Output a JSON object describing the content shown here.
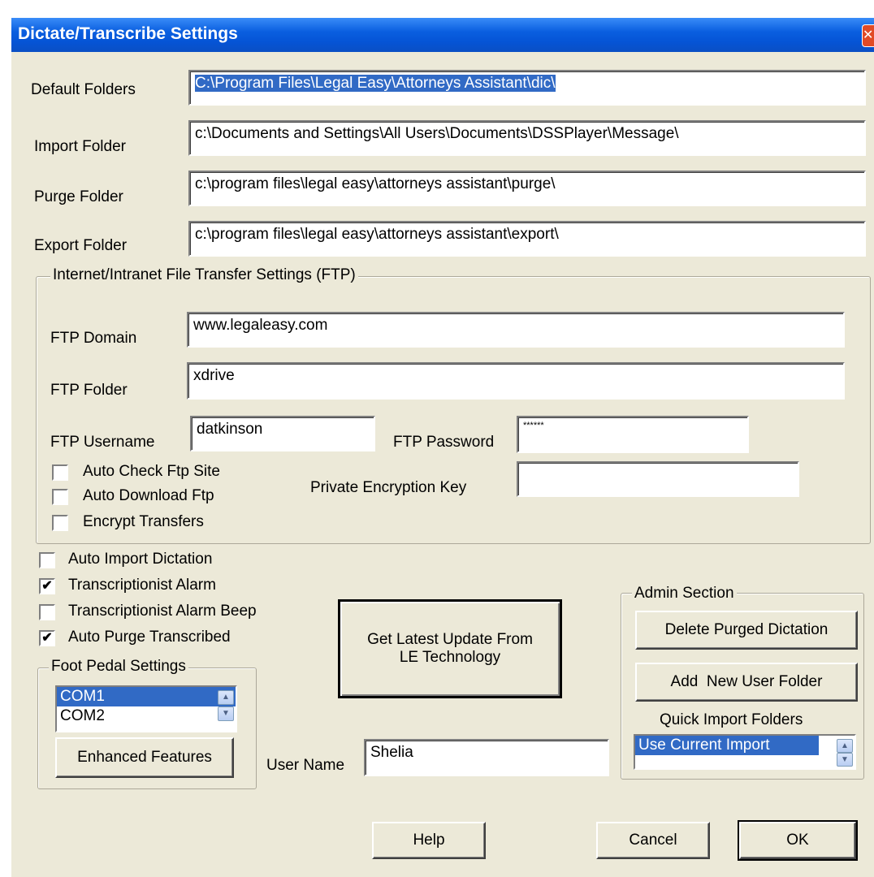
{
  "window": {
    "title": "Dictate/Transcribe Settings",
    "close_glyph": "✕"
  },
  "folders": {
    "default_label": "Default Folders",
    "default_value": "C:\\Program Files\\Legal Easy\\Attorneys Assistant\\dic\\",
    "import_label": "Import Folder",
    "import_value": "c:\\Documents and Settings\\All Users\\Documents\\DSSPlayer\\Message\\",
    "purge_label": "Purge Folder",
    "purge_value": "c:\\program files\\legal easy\\attorneys assistant\\purge\\",
    "export_label": "Export Folder",
    "export_value": "c:\\program files\\legal easy\\attorneys assistant\\export\\"
  },
  "ftp": {
    "group_label": "Internet/Intranet File Transfer Settings (FTP)",
    "domain_label": "FTP Domain",
    "domain_value": "www.legaleasy.com",
    "folder_label": "FTP Folder",
    "folder_value": "xdrive",
    "username_label": "FTP Username",
    "username_value": "datkinson",
    "password_label": "FTP Password",
    "password_value": "******",
    "encryption_key_label": "Private Encryption Key",
    "encryption_key_value": "",
    "checkboxes": [
      {
        "label": "Auto Check Ftp Site",
        "checked": false
      },
      {
        "label": "Auto Download Ftp",
        "checked": false
      },
      {
        "label": "Encrypt Transfers",
        "checked": false
      }
    ]
  },
  "options": [
    {
      "label": "Auto Import Dictation",
      "checked": false
    },
    {
      "label": "Transcriptionist Alarm",
      "checked": true
    },
    {
      "label": "Transcriptionist Alarm Beep",
      "checked": false
    },
    {
      "label": "Auto Purge Transcribed",
      "checked": true
    }
  ],
  "check_glyph": "✔",
  "foot_pedal": {
    "group_label": "Foot Pedal Settings",
    "ports": [
      "COM1",
      "COM2"
    ],
    "selected": "COM1",
    "enhanced_button": "Enhanced Features"
  },
  "update_button": {
    "line1": "Get Latest Update From",
    "line2": "LE Technology"
  },
  "user": {
    "label": "User Name",
    "value": "Shelia"
  },
  "admin": {
    "group_label": "Admin Section",
    "delete_button": "Delete Purged Dictation",
    "add_folder_button": "Add  New User Folder",
    "quick_import_label": "Quick Import Folders",
    "quick_import_selected": "Use Current Import"
  },
  "footer": {
    "help": "Help",
    "cancel": "Cancel",
    "ok": "OK"
  },
  "spin_up": "▲",
  "spin_down": "▼"
}
